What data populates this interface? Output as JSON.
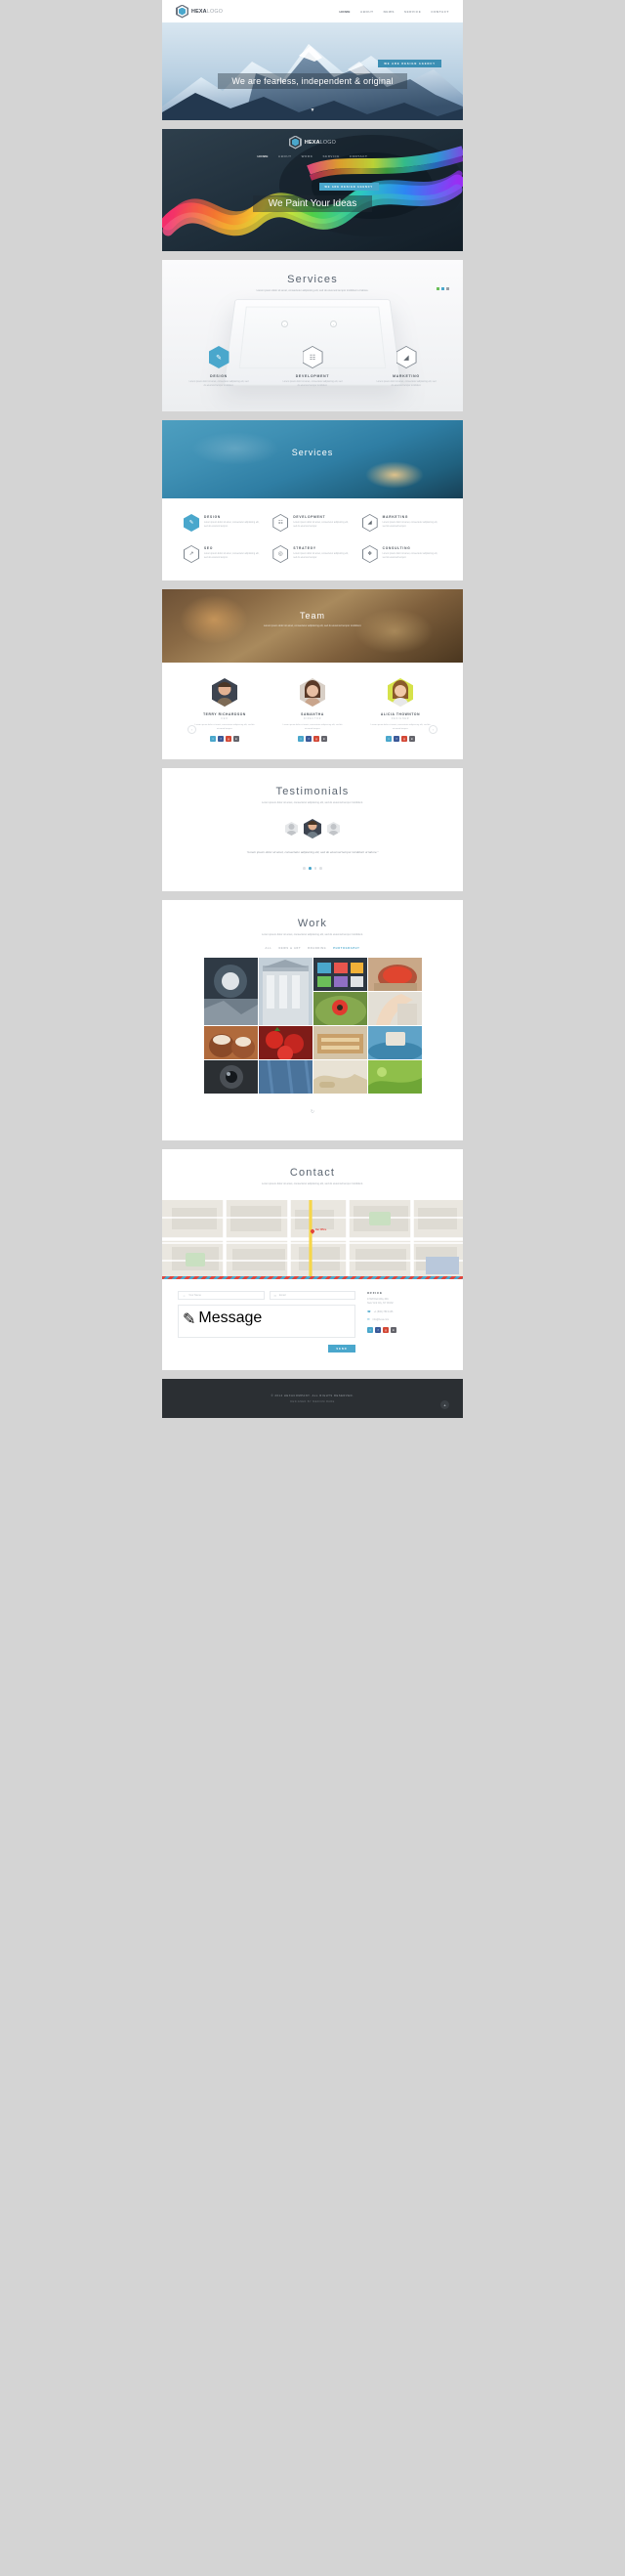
{
  "brand": {
    "name_bold": "HEXA",
    "name_light": "LOGO"
  },
  "header_light": {
    "nav": [
      {
        "label": "HOME",
        "active": true
      },
      {
        "label": "ABOUT",
        "active": false
      },
      {
        "label": "NEWS",
        "active": false
      },
      {
        "label": "SERVICE",
        "active": false
      },
      {
        "label": "CONTACT",
        "active": false
      }
    ]
  },
  "header_dark": {
    "nav": [
      {
        "label": "HOME",
        "active": true
      },
      {
        "label": "ABOUT",
        "active": false
      },
      {
        "label": "WORK",
        "active": false
      },
      {
        "label": "SERVICE",
        "active": false
      },
      {
        "label": "CONTACT",
        "active": false
      }
    ]
  },
  "hero1": {
    "badge": "WE ARE DESIGN AGENCY",
    "headline": "We are fearless, independent & original",
    "scroll_icon": "▼"
  },
  "hero2": {
    "badge": "WE ARE DESIGN AGENCY",
    "headline": "We Paint Your Ideas"
  },
  "services_light": {
    "title": "Services",
    "subtitle": "Lorem ipsum dolor sit amet, consectetur adipisicing elit, sed do eiusmod tempor incididunt ut labore.",
    "prev": "‹",
    "next": "›",
    "items": [
      {
        "icon": "pencil-hexagon-icon",
        "glyph": "✎",
        "name": "DESIGN",
        "text": "Lorem ipsum dolor sit amet, consectetur adipisicing elit, sed do eiusmod tempor incididunt.",
        "filled": true
      },
      {
        "icon": "code-monitor-hexagon-icon",
        "glyph": "⌨",
        "name": "DEVELOPMENT",
        "text": "Lorem ipsum dolor sit amet, consectetur adipisicing elit, sed do eiusmod tempor incididunt.",
        "filled": false
      },
      {
        "icon": "megaphone-hexagon-icon",
        "glyph": "◢",
        "name": "MARKETING",
        "text": "Lorem ipsum dolor sit amet, consectetur adipisicing elit, sed do eiusmod tempor incididunt.",
        "filled": false
      }
    ]
  },
  "services_banner": {
    "title": "Services"
  },
  "services_grid": {
    "items": [
      {
        "icon": "pencil-hexagon-icon",
        "glyph": "✎",
        "name": "DESIGN",
        "text": "Lorem ipsum dolor sit amet, consectetur adipisicing elit, sed do eiusmod tempor.",
        "filled": true
      },
      {
        "icon": "code-monitor-hexagon-icon",
        "glyph": "⌨",
        "name": "DEVELOPMENT",
        "text": "Lorem ipsum dolor sit amet, consectetur adipisicing elit, sed do eiusmod tempor.",
        "filled": false
      },
      {
        "icon": "megaphone-hexagon-icon",
        "glyph": "◢",
        "name": "MARKETING",
        "text": "Lorem ipsum dolor sit amet, consectetur adipisicing elit, sed do eiusmod tempor.",
        "filled": false
      },
      {
        "icon": "chart-hexagon-icon",
        "glyph": "↑",
        "name": "SEO",
        "text": "Lorem ipsum dolor sit amet, consectetur adipisicing elit, sed do eiusmod tempor.",
        "filled": false
      },
      {
        "icon": "target-hexagon-icon",
        "glyph": "◎",
        "name": "STRATEGY",
        "text": "Lorem ipsum dolor sit amet, consectetur adipisicing elit, sed do eiusmod tempor.",
        "filled": false
      },
      {
        "icon": "chat-hexagon-icon",
        "glyph": "❖",
        "name": "CONSULTING",
        "text": "Lorem ipsum dolor sit amet, consectetur adipisicing elit, sed do eiusmod tempor.",
        "filled": false
      }
    ]
  },
  "team_banner": {
    "title": "Team",
    "subtitle": "Lorem ipsum dolor sit amet, consectetur adipisicing elit, sed do eiusmod tempor incididunt."
  },
  "team": {
    "prev": "‹",
    "next": "›",
    "members": [
      {
        "name": "TERRY RICHARDSON",
        "role": "CEO",
        "text": "Lorem ipsum dolor sit amet, consectetur adipisicing elit, sed do eiusmod tempor.",
        "socials": [
          "twitter-icon",
          "facebook-icon",
          "google-plus-icon",
          "linkedin-icon"
        ]
      },
      {
        "name": "SAMANTHA",
        "role": "DIRECTOR",
        "text": "Lorem ipsum dolor sit amet, consectetur adipisicing elit, sed do eiusmod tempor.",
        "socials": [
          "twitter-icon",
          "facebook-icon",
          "google-plus-icon",
          "linkedin-icon"
        ]
      },
      {
        "name": "ALICIA THOWNTON",
        "role": "DESIGNER",
        "text": "Lorem ipsum dolor sit amet, consectetur adipisicing elit, sed do eiusmod tempor.",
        "socials": [
          "twitter-icon",
          "facebook-icon",
          "google-plus-icon",
          "linkedin-icon"
        ]
      }
    ]
  },
  "testimonials": {
    "title": "Testimonials",
    "subtitle": "Lorem ipsum dolor sit amet, consectetur adipisicing elit, sed do eiusmod tempor incididunt.",
    "quote": "\"Lorem ipsum dolor sit amet, consectetur adipisicing elit, sed do eiusmod tempor incididunt ut labore.\"",
    "dots": [
      false,
      true,
      false,
      false
    ]
  },
  "work": {
    "title": "Work",
    "subtitle": "Lorem ipsum dolor sit amet, consectetur adipisicing elit, sed do eiusmod tempor incididunt.",
    "filters": [
      {
        "label": "ALL",
        "on": false
      },
      {
        "label": "NEWS & ART",
        "on": false
      },
      {
        "label": "BRANDING",
        "on": false
      },
      {
        "label": "PHOTOGRAPHY",
        "on": true
      }
    ],
    "more_icon": "↻"
  },
  "contact": {
    "title": "Contact",
    "subtitle": "Lorem ipsum dolor sit amet, consectetur adipisicing elit, sed do eiusmod tempor incididunt.",
    "map_pin_label": "Our Office",
    "name_placeholder": "Your Name",
    "email_placeholder": "Email",
    "message_placeholder": "Message",
    "send_label": "SEND",
    "office_title": "OFFICE",
    "office_address": "47428 Dali Way 400,\nNew York City, NY 00132",
    "phone": "+1 (800) 789 4136",
    "email": "info@hexa.com",
    "socials": [
      "twitter-icon",
      "facebook-icon",
      "google-plus-icon",
      "linkedin-icon"
    ],
    "icons": {
      "name": "user-icon",
      "email": "envelope-icon",
      "message": "pencil-icon",
      "phone": "phone-icon",
      "mail": "envelope-icon"
    }
  },
  "footer": {
    "line1": "© 2014 HEXACOMPANY. ALL RIGHTS RESERVED.",
    "line2": "DESIGNED BY MEDIUM RARE",
    "back_to_top": "▲"
  },
  "colors": {
    "accent": "#4aa7cc",
    "dark": "#2b2f33",
    "text": "#4d545c",
    "muted": "#b5bac0"
  }
}
